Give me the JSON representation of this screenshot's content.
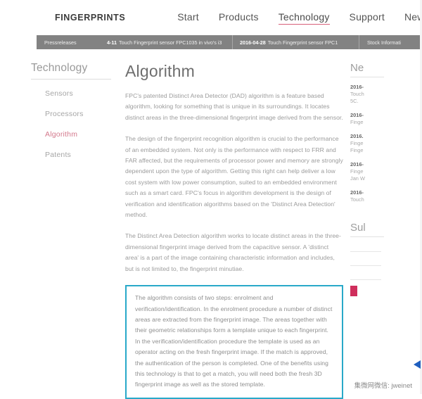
{
  "header": {
    "brand": "FINGERPRINTS",
    "nav": [
      {
        "label": "Start",
        "active": false
      },
      {
        "label": "Products",
        "active": false
      },
      {
        "label": "Technology",
        "active": true
      },
      {
        "label": "Support",
        "active": false
      },
      {
        "label": "News",
        "active": false
      }
    ]
  },
  "ticker": {
    "label": "Pressreleases",
    "items": [
      {
        "date": "4-11",
        "text": "Touch Fingerprint sensor FPC1035 in vivo's i3"
      },
      {
        "date": "2016-04-28",
        "text": "Touch Fingerprint sensor FPC1"
      }
    ],
    "stock_label": "Stock Informati"
  },
  "sidebar": {
    "title": "Technology",
    "items": [
      {
        "label": "Sensors",
        "active": false
      },
      {
        "label": "Processors",
        "active": false
      },
      {
        "label": "Algorithm",
        "active": true
      },
      {
        "label": "Patents",
        "active": false
      }
    ]
  },
  "main": {
    "title": "Algorithm",
    "paragraphs": [
      "FPC's patented Distinct Area Detector (DAD) algorithm is a feature based algorithm, looking for something that is unique in its surroundings. It locates distinct areas in the three-dimensional fingerprint image derived from the sensor.",
      "The design of the fingerprint recognition algorithm is crucial to the performance of an embedded system. Not only is the performance with respect to FRR and FAR affected, but the requirements of processor power and memory are strongly dependent upon the type of algorithm. Getting this right can help deliver a low cost system with low power consumption, suited to an embedded environment such as a smart card. FPC's focus in algorithm development is the design of verification and identification algorithms based on the 'Distinct Area Detection' method.",
      "The Distinct Area Detection algorithm works to locate distinct areas in the three-dimensional fingerprint image derived from the capacitive sensor. A 'distinct area' is a part of the image containing characteristic information and includes, but is not limited to, the fingerprint minutiae."
    ],
    "highlight": "The algorithm consists of two steps: enrolment and verification/identification. In the enrolment procedure a number of distinct areas are extracted from the fingerprint image. The areas together with their geometric relationships form a template unique to each fingerprint. In the verification/identification procedure the template is used as an operator acting on the fresh fingerprint image. If the match is approved, the authentication of the person is completed. One of the benefits using this technology is that to get a match, you will need both the fresh 3D fingerprint image as well as the stored template."
  },
  "rail": {
    "news_heading": "Ne",
    "entries": [
      {
        "date": "2016-",
        "line1": "Touch",
        "line2": "5C."
      },
      {
        "date": "2016-",
        "line1": "Finge",
        "line2": ""
      },
      {
        "date": "2016.",
        "line1": "Finge",
        "line2": "Finge"
      },
      {
        "date": "2016-",
        "line1": "Finge",
        "line2": "Jan W"
      },
      {
        "date": "2016-",
        "line1": "Touch",
        "line2": ""
      }
    ],
    "subscribe_heading": "Sul",
    "fields": [
      "",
      "",
      ""
    ]
  },
  "watermark": "集微网微信: jweinet",
  "colors": {
    "accent_pink": "#d8607a",
    "highlight_border": "#29a9c9",
    "ticker_bg": "#828282",
    "button_pink": "#cf2e5c",
    "cursor_blue": "#1f5fbf"
  }
}
